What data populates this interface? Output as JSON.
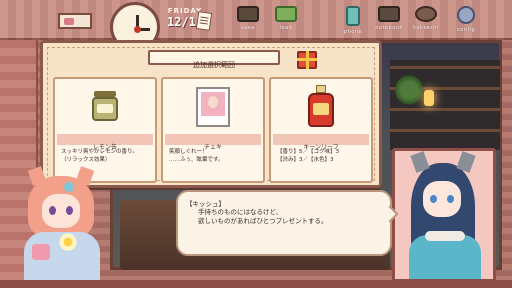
{
  "topbar": {
    "date": {
      "day": "FRIDAY",
      "date": "12/13"
    },
    "buttons": [
      {
        "key": "save",
        "label": "save",
        "icon": "cassette-icon"
      },
      {
        "key": "load",
        "label": "load",
        "icon": "play-icon"
      },
      {
        "key": "phone",
        "label": "phone",
        "icon": "phone-icon"
      },
      {
        "key": "notebook",
        "label": "notebook",
        "icon": "notebook-icon"
      },
      {
        "key": "pet",
        "label": "kokkeshi",
        "icon": "pet-icon"
      },
      {
        "key": "settings",
        "label": "config",
        "icon": "gear-icon"
      }
    ]
  },
  "panel": {
    "title": "追加選択範囲",
    "items": [
      {
        "name": "レモン缶",
        "desc": "スッキリ爽やかレモンの香り。\n（リラックス効果）"
      },
      {
        "name": "チェキ",
        "desc": "笑顔しぐれー！\n……ふぅ、眩暈です。"
      },
      {
        "name": "キーンリーフ",
        "desc": "【香り】5／【コク味】3\n【渋み】3／【水色】3"
      }
    ]
  },
  "dialog": {
    "speaker": "【キッシュ】",
    "text": "手持ちのものにはなるけど、\n欲しいものがあればひとつプレゼントする。"
  },
  "colors": {
    "frame": "#8b4f48",
    "panel_bg": "#f7e3c8",
    "card_name_bar": "#f1c6b6",
    "accent_gift": "#e34d3c"
  }
}
